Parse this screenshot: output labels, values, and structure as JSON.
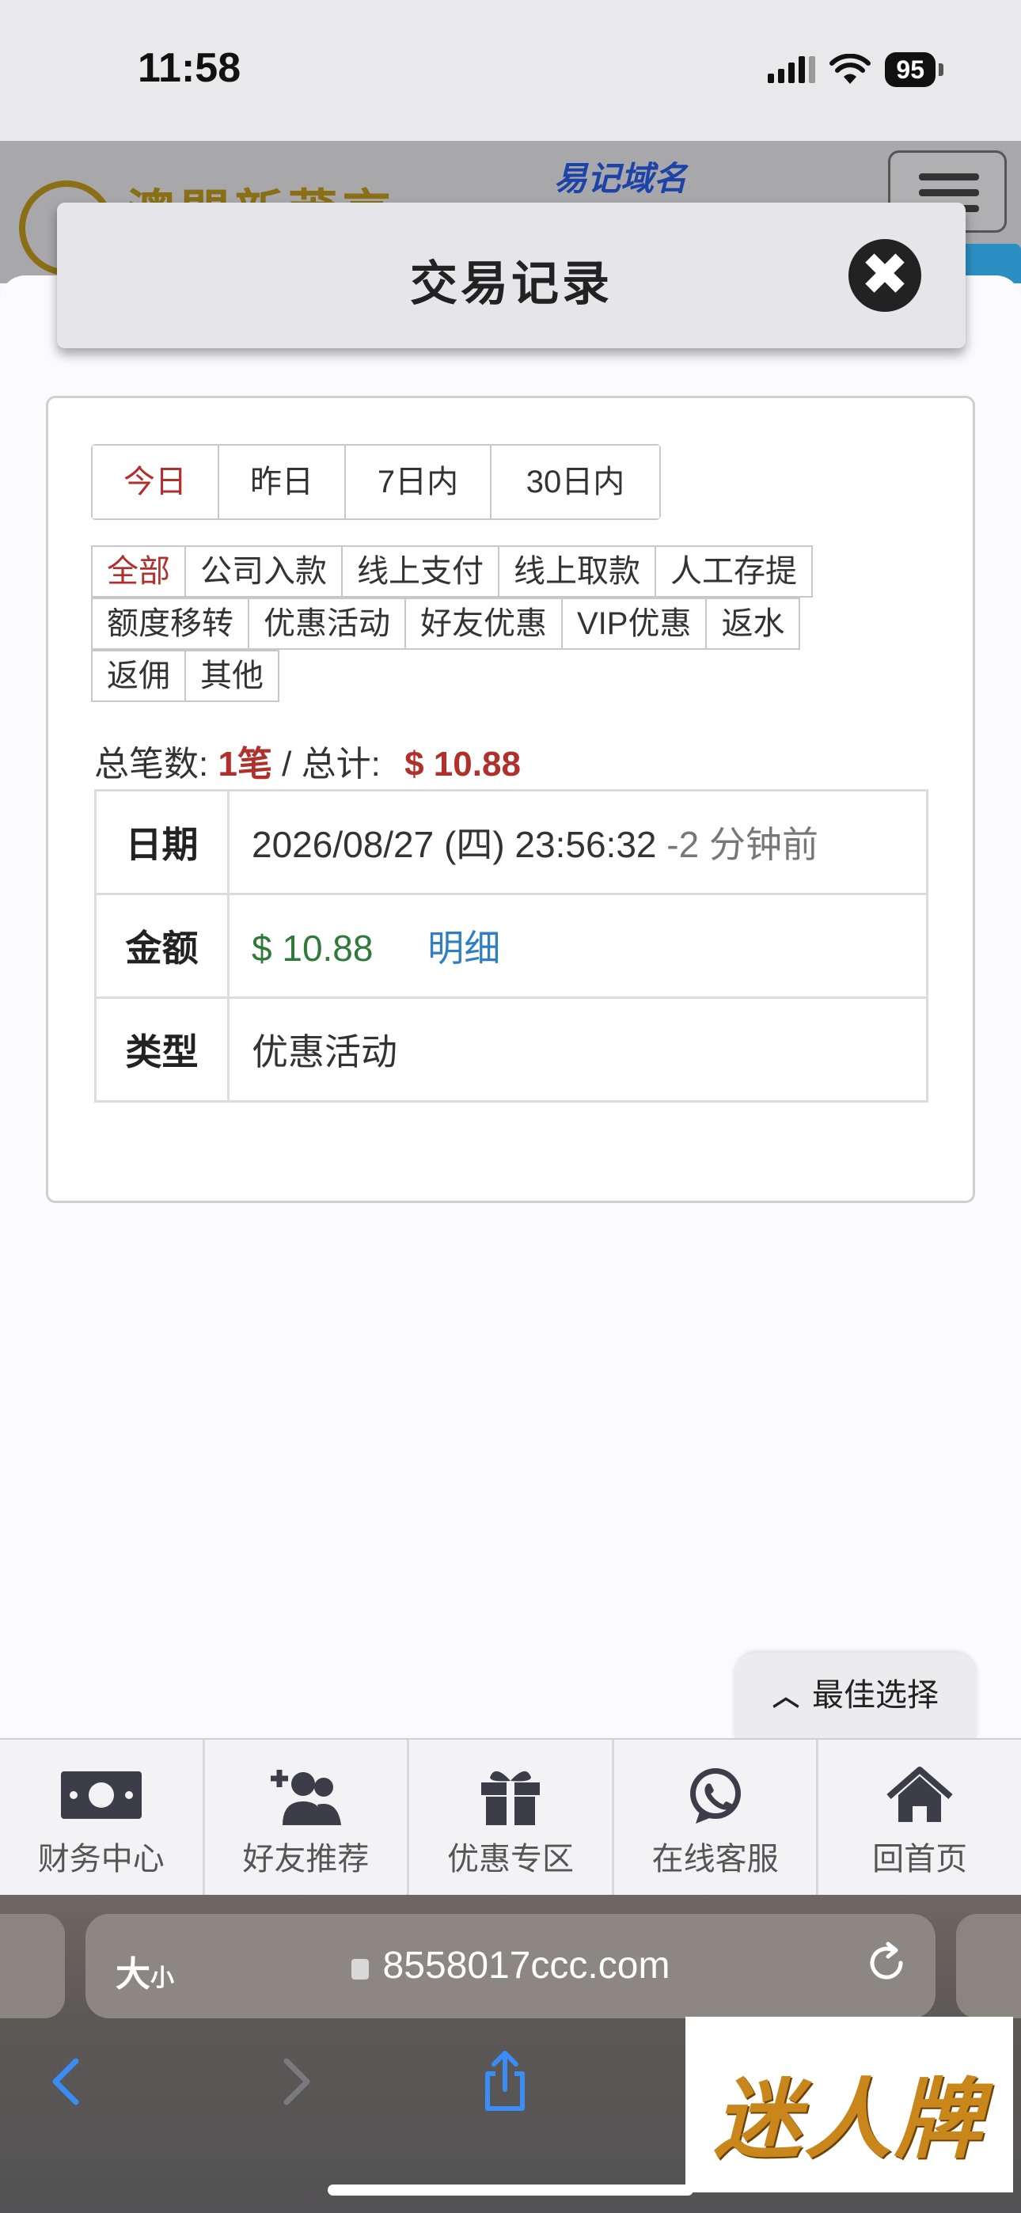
{
  "status_bar": {
    "time": "11:58",
    "battery": "95"
  },
  "site": {
    "logo_text": "澳門新莆京",
    "domain_label": "易记域名"
  },
  "modal": {
    "title": "交易记录",
    "close_icon": "close-icon"
  },
  "date_tabs": [
    {
      "label": "今日",
      "active": true
    },
    {
      "label": "昨日",
      "active": false
    },
    {
      "label": "7日内",
      "active": false
    },
    {
      "label": "30日内",
      "active": false
    }
  ],
  "type_filters": {
    "row1": [
      "全部",
      "公司入款",
      "线上支付",
      "线上取款",
      "人工存提"
    ],
    "row2": [
      "额度移转",
      "优惠活动",
      "好友优惠",
      "VIP优惠",
      "返水"
    ],
    "row3": [
      "返佣",
      "其他"
    ],
    "active": "全部"
  },
  "summary": {
    "count_label": "总笔数:",
    "count_value": "1笔",
    "separator": " / ",
    "total_label": "总计:",
    "total_value": "$ 10.88"
  },
  "record": {
    "date_label": "日期",
    "date_value": "2026/08/27 (四) 23:56:32",
    "date_relative": "-2 分钟前",
    "amount_label": "金额",
    "amount_value": "$ 10.88",
    "amount_detail_link": "明细",
    "type_label": "类型",
    "type_value": "优惠活动"
  },
  "best_choice": {
    "label": "最佳选择",
    "icon": "chevron-up-icon"
  },
  "bottom_nav": [
    {
      "label": "财务中心",
      "icon": "money-icon"
    },
    {
      "label": "好友推荐",
      "icon": "user-plus-icon"
    },
    {
      "label": "优惠专区",
      "icon": "gift-icon"
    },
    {
      "label": "在线客服",
      "icon": "whatsapp-icon"
    },
    {
      "label": "回首页",
      "icon": "home-icon"
    }
  ],
  "browser": {
    "size_label": "大",
    "size_label_small": "小",
    "url": "8558017ccc.com"
  },
  "ad": {
    "text": "迷人牌"
  },
  "colors": {
    "active_red": "#b0302c",
    "amount_green": "#2f7a3a",
    "link_blue": "#2e7fc4"
  }
}
